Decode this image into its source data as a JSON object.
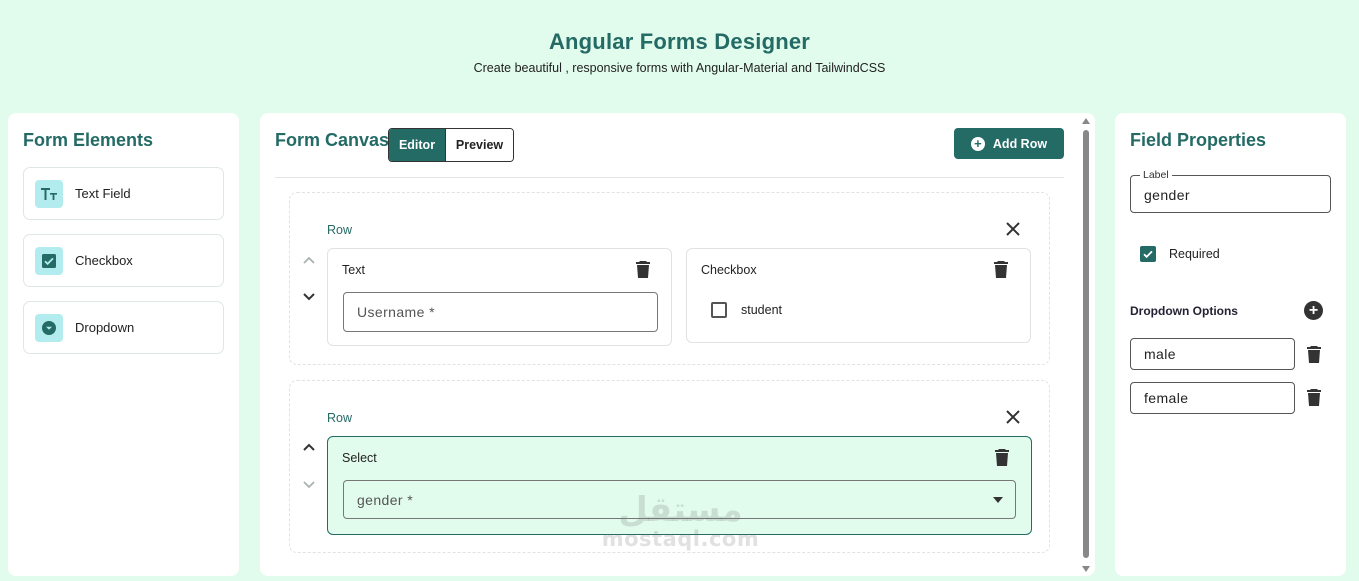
{
  "header": {
    "title": "Angular Forms Designer",
    "subtitle": "Create beautiful , responsive forms with Angular-Material and TailwindCSS"
  },
  "elements_panel": {
    "title": "Form Elements",
    "items": [
      {
        "label": "Text Field",
        "icon": "text-format-icon"
      },
      {
        "label": "Checkbox",
        "icon": "checkbox-icon"
      },
      {
        "label": "Dropdown",
        "icon": "dropdown-icon"
      }
    ]
  },
  "canvas": {
    "title": "Form Canvas",
    "toggle": {
      "editor": "Editor",
      "preview": "Preview",
      "active": "Editor"
    },
    "add_row_label": "Add Row",
    "rows": [
      {
        "label": "Row",
        "fields": [
          {
            "type": "Text",
            "placeholder": "Username *"
          },
          {
            "type": "Checkbox",
            "option_label": "student",
            "checked": false
          }
        ]
      },
      {
        "label": "Row",
        "fields": [
          {
            "type": "Select",
            "value": "gender *",
            "selected": true
          }
        ]
      }
    ]
  },
  "properties_panel": {
    "title": "Field Properties",
    "label_caption": "Label",
    "label_value": "gender",
    "required_label": "Required",
    "required_checked": true,
    "options_title": "Dropdown Options",
    "options": [
      "male",
      "female"
    ]
  },
  "watermark": {
    "arabic": "مستقل",
    "latin": "mostaql.com"
  },
  "colors": {
    "background": "#e1fcec",
    "accent": "#246a65",
    "icon_bg": "#b3ecee",
    "panel": "#ffffff"
  }
}
